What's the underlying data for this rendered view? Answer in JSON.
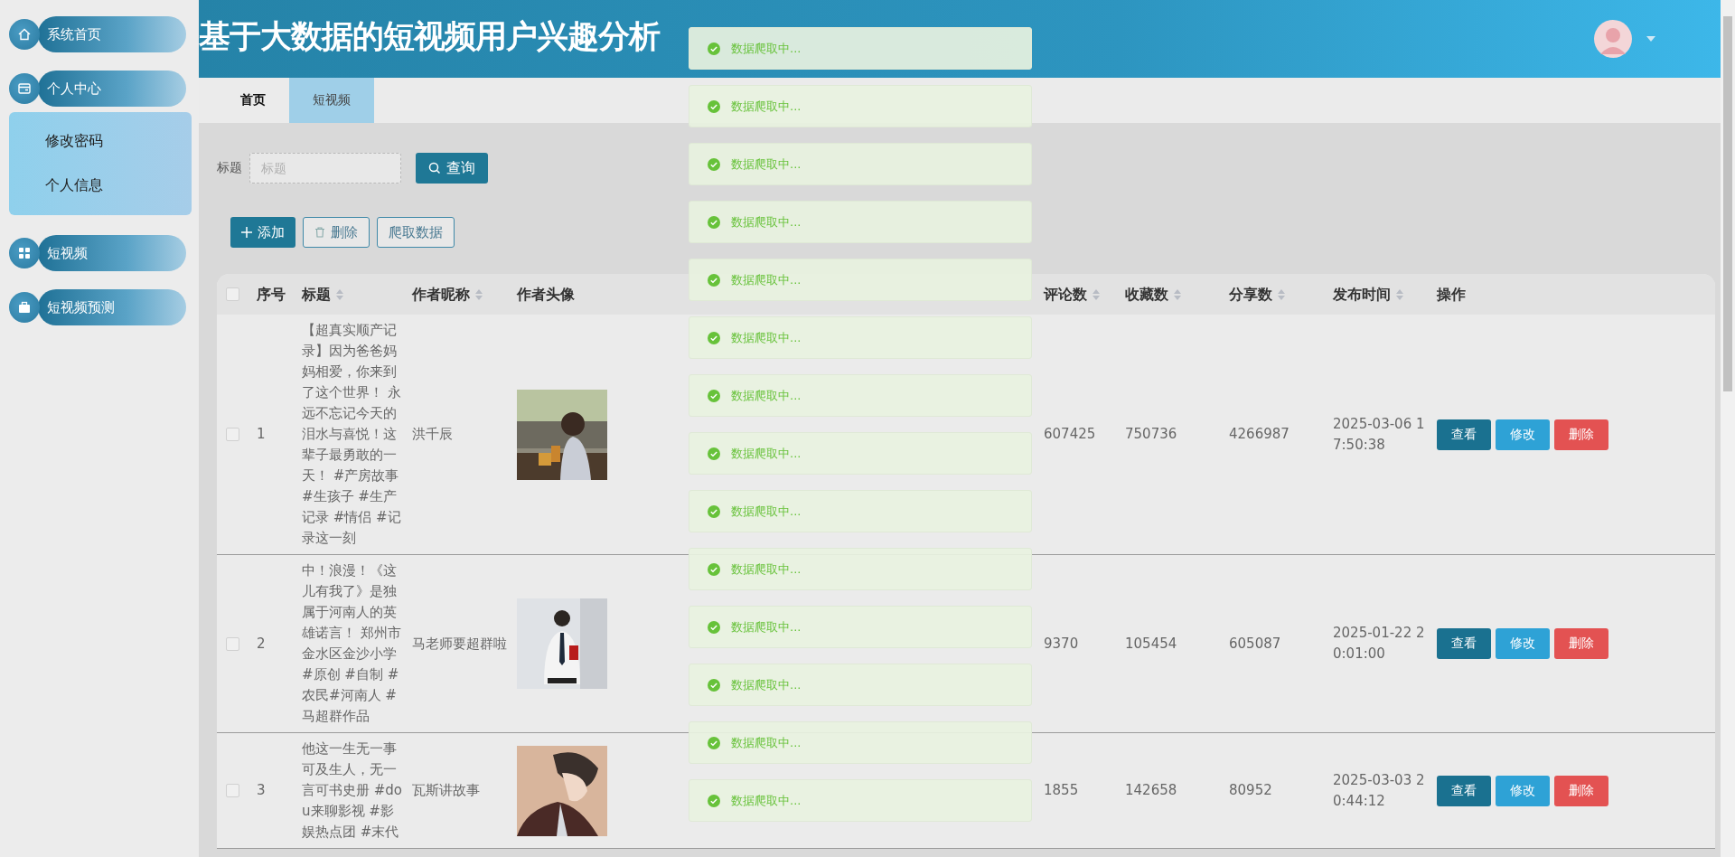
{
  "sidebar": {
    "items": [
      {
        "label": "系统首页"
      },
      {
        "label": "个人中心",
        "children": [
          {
            "label": "修改密码"
          },
          {
            "label": "个人信息"
          }
        ]
      },
      {
        "label": "短视频"
      },
      {
        "label": "短视频预测"
      }
    ]
  },
  "header": {
    "title": "基于大数据的短视频用户兴趣分析"
  },
  "tabs": [
    {
      "label": "首页",
      "selected": false
    },
    {
      "label": "短视频",
      "selected": true
    }
  ],
  "search": {
    "label": "标题",
    "placeholder": "标题",
    "button": "查询"
  },
  "toolbar": [
    {
      "label": "添加",
      "kind": "add"
    },
    {
      "label": "删除",
      "kind": "delete"
    },
    {
      "label": "爬取数据",
      "kind": "crawl"
    }
  ],
  "table": {
    "all_selected": false,
    "columns": [
      {
        "label": "序号",
        "sortable": false
      },
      {
        "label": "标题",
        "sortable": true
      },
      {
        "label": "作者昵称",
        "sortable": true
      },
      {
        "label": "作者头像",
        "sortable": false
      },
      {
        "label": "评论数",
        "sortable": true
      },
      {
        "label": "收藏数",
        "sortable": true
      },
      {
        "label": "分享数",
        "sortable": true
      },
      {
        "label": "发布时间",
        "sortable": true
      },
      {
        "label": "操作",
        "sortable": false
      }
    ],
    "rows": [
      {
        "selected": false,
        "index": "1",
        "title": "【超真实顺产记录】因为爸爸妈妈相爱，你来到了这个世界！ 永远不忘记今天的泪水与喜悦！这辈子最勇敢的一天！ #产房故事 #生孩子 #生产记录 #情侣 #记录这一刻",
        "author": "洪千辰",
        "avatar": {
          "kind": "picture"
        },
        "comments": "607425",
        "favorites": "750736",
        "shares": "4266987",
        "published": "2025-03-06 17:50:38",
        "actions": [
          {
            "label": "查看",
            "kind": "view"
          },
          {
            "label": "修改",
            "kind": "edit"
          },
          {
            "label": "删除",
            "kind": "delete"
          }
        ]
      },
      {
        "selected": false,
        "index": "2",
        "title": "中！浪漫！《这儿有我了》是独属于河南人的英雄诺言！ 郑州市金水区金沙小学 #原创 #自制 #农民#河南人 #马超群作品",
        "author": "马老师要超群啦",
        "avatar": {
          "kind": "picture"
        },
        "comments": "9370",
        "favorites": "105454",
        "shares": "605087",
        "published": "2025-01-22 20:01:00",
        "actions": [
          {
            "label": "查看",
            "kind": "view"
          },
          {
            "label": "修改",
            "kind": "edit"
          },
          {
            "label": "删除",
            "kind": "delete"
          }
        ]
      },
      {
        "selected": false,
        "index": "3",
        "title": "他这一生无一事可及生人，无一言可书史册 #dou来聊影视 #影娱热点团 #末代",
        "author": "瓦斯讲故事",
        "avatar": {
          "kind": "picture"
        },
        "comments": "1855",
        "favorites": "142658",
        "shares": "80952",
        "published": "2025-03-03 20:44:12",
        "actions": [
          {
            "label": "查看",
            "kind": "view"
          },
          {
            "label": "修改",
            "kind": "edit"
          },
          {
            "label": "删除",
            "kind": "delete"
          }
        ]
      }
    ]
  },
  "toasts": [
    {
      "message": "数据爬取中..."
    },
    {
      "message": "数据爬取中..."
    },
    {
      "message": "数据爬取中..."
    },
    {
      "message": "数据爬取中..."
    },
    {
      "message": "数据爬取中..."
    },
    {
      "message": "数据爬取中..."
    },
    {
      "message": "数据爬取中..."
    },
    {
      "message": "数据爬取中..."
    },
    {
      "message": "数据爬取中..."
    },
    {
      "message": "数据爬取中..."
    },
    {
      "message": "数据爬取中..."
    },
    {
      "message": "数据爬取中..."
    },
    {
      "message": "数据爬取中..."
    },
    {
      "message": "数据爬取中..."
    }
  ]
}
